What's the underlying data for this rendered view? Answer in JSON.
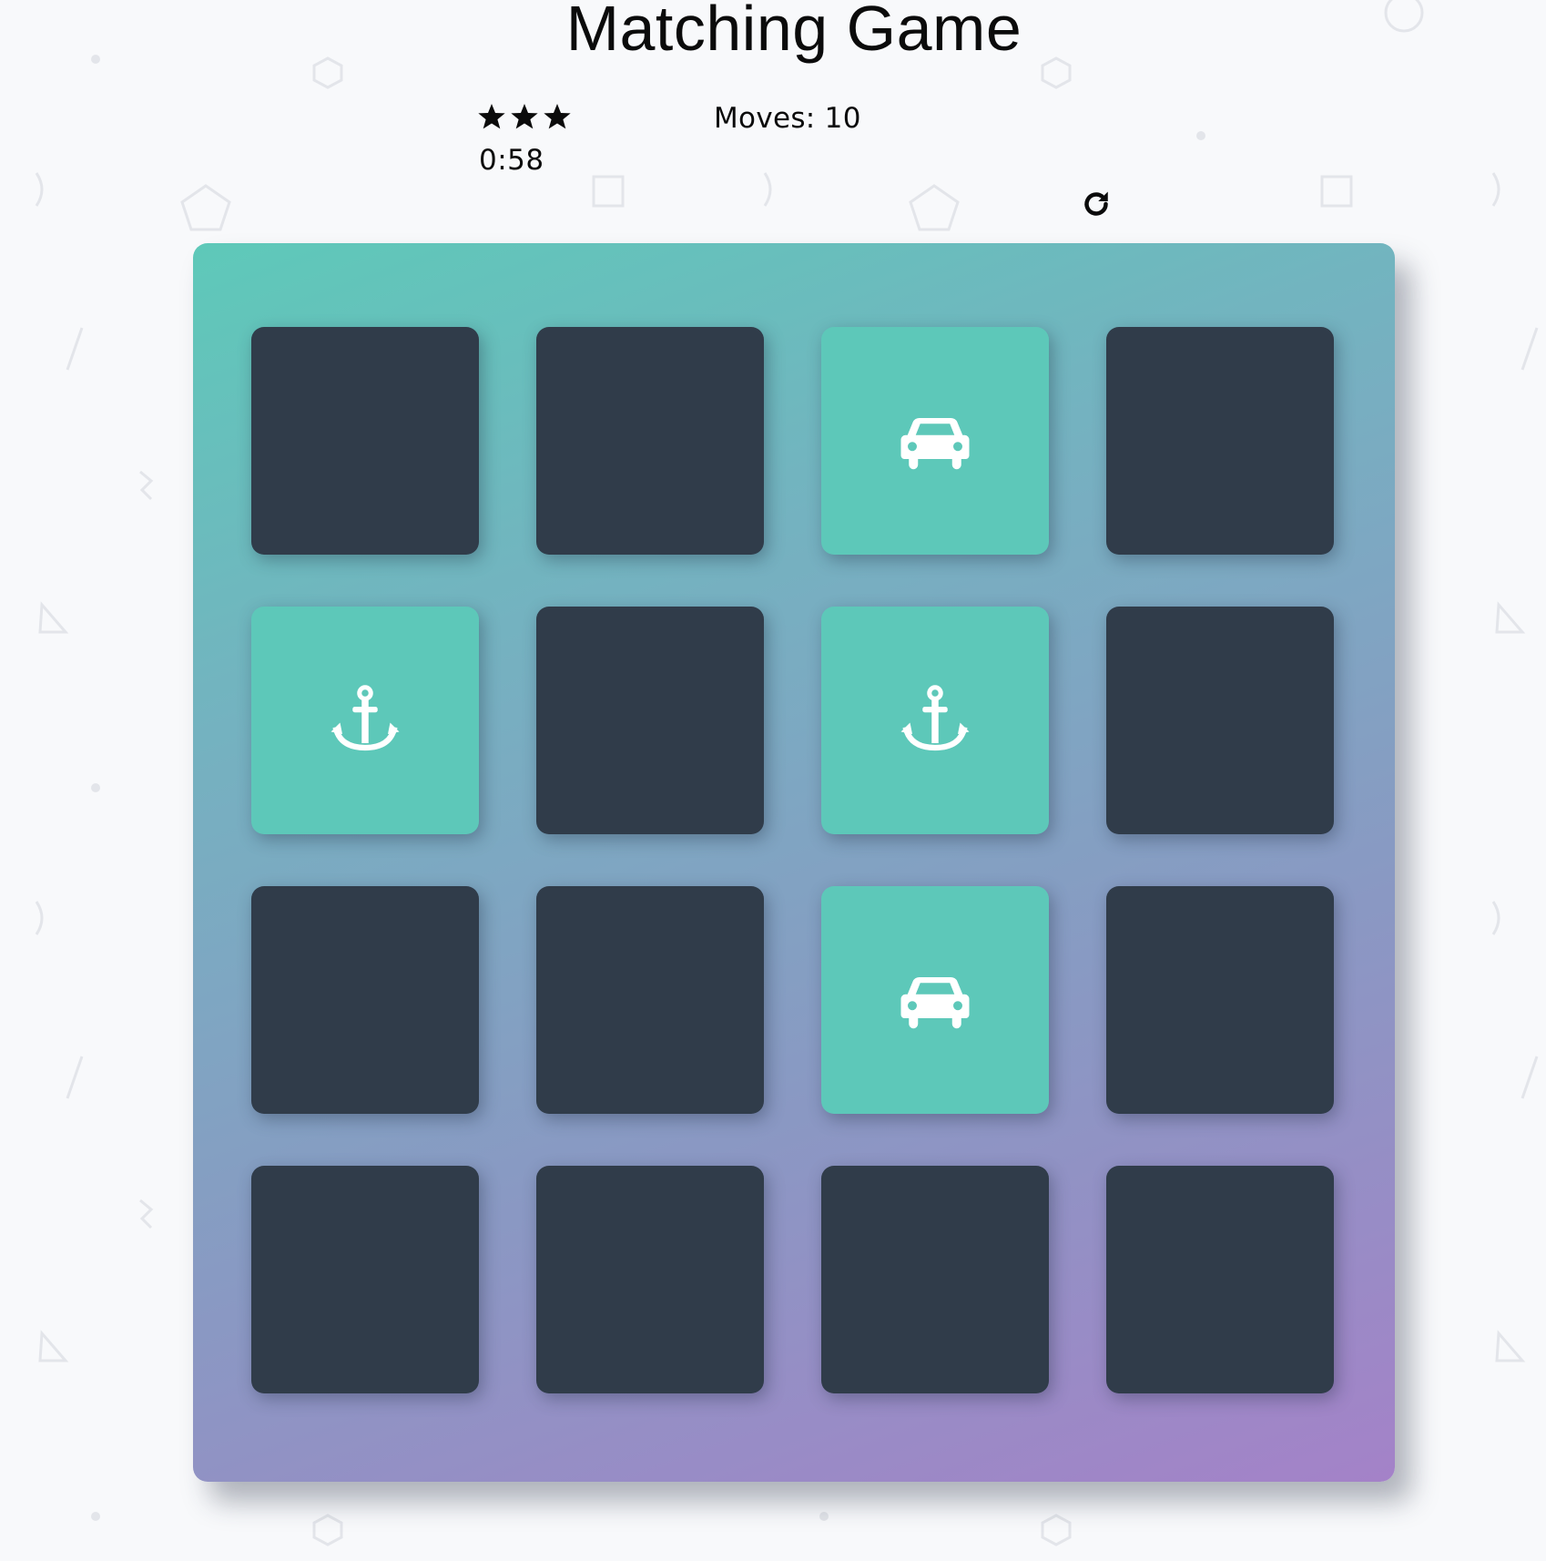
{
  "game": {
    "title": "Matching Game",
    "timer": "0:58",
    "moves_text": "Moves: 10",
    "star_rating": 3,
    "restart_icon": "restart-icon"
  },
  "colors": {
    "board_gradient_start": "#5ec9b9",
    "board_gradient_end": "#a482c8",
    "card_back": "#303c4a",
    "card_open": "#5dc8b9",
    "icon": "#ffffff"
  },
  "cards": [
    {
      "state": "closed",
      "icon": ""
    },
    {
      "state": "closed",
      "icon": ""
    },
    {
      "state": "open",
      "icon": "car-icon"
    },
    {
      "state": "closed",
      "icon": ""
    },
    {
      "state": "open",
      "icon": "anchor-icon"
    },
    {
      "state": "closed",
      "icon": ""
    },
    {
      "state": "open",
      "icon": "anchor-icon"
    },
    {
      "state": "closed",
      "icon": ""
    },
    {
      "state": "closed",
      "icon": ""
    },
    {
      "state": "closed",
      "icon": ""
    },
    {
      "state": "open",
      "icon": "car-icon"
    },
    {
      "state": "closed",
      "icon": ""
    },
    {
      "state": "closed",
      "icon": ""
    },
    {
      "state": "closed",
      "icon": ""
    },
    {
      "state": "closed",
      "icon": ""
    },
    {
      "state": "closed",
      "icon": ""
    }
  ]
}
